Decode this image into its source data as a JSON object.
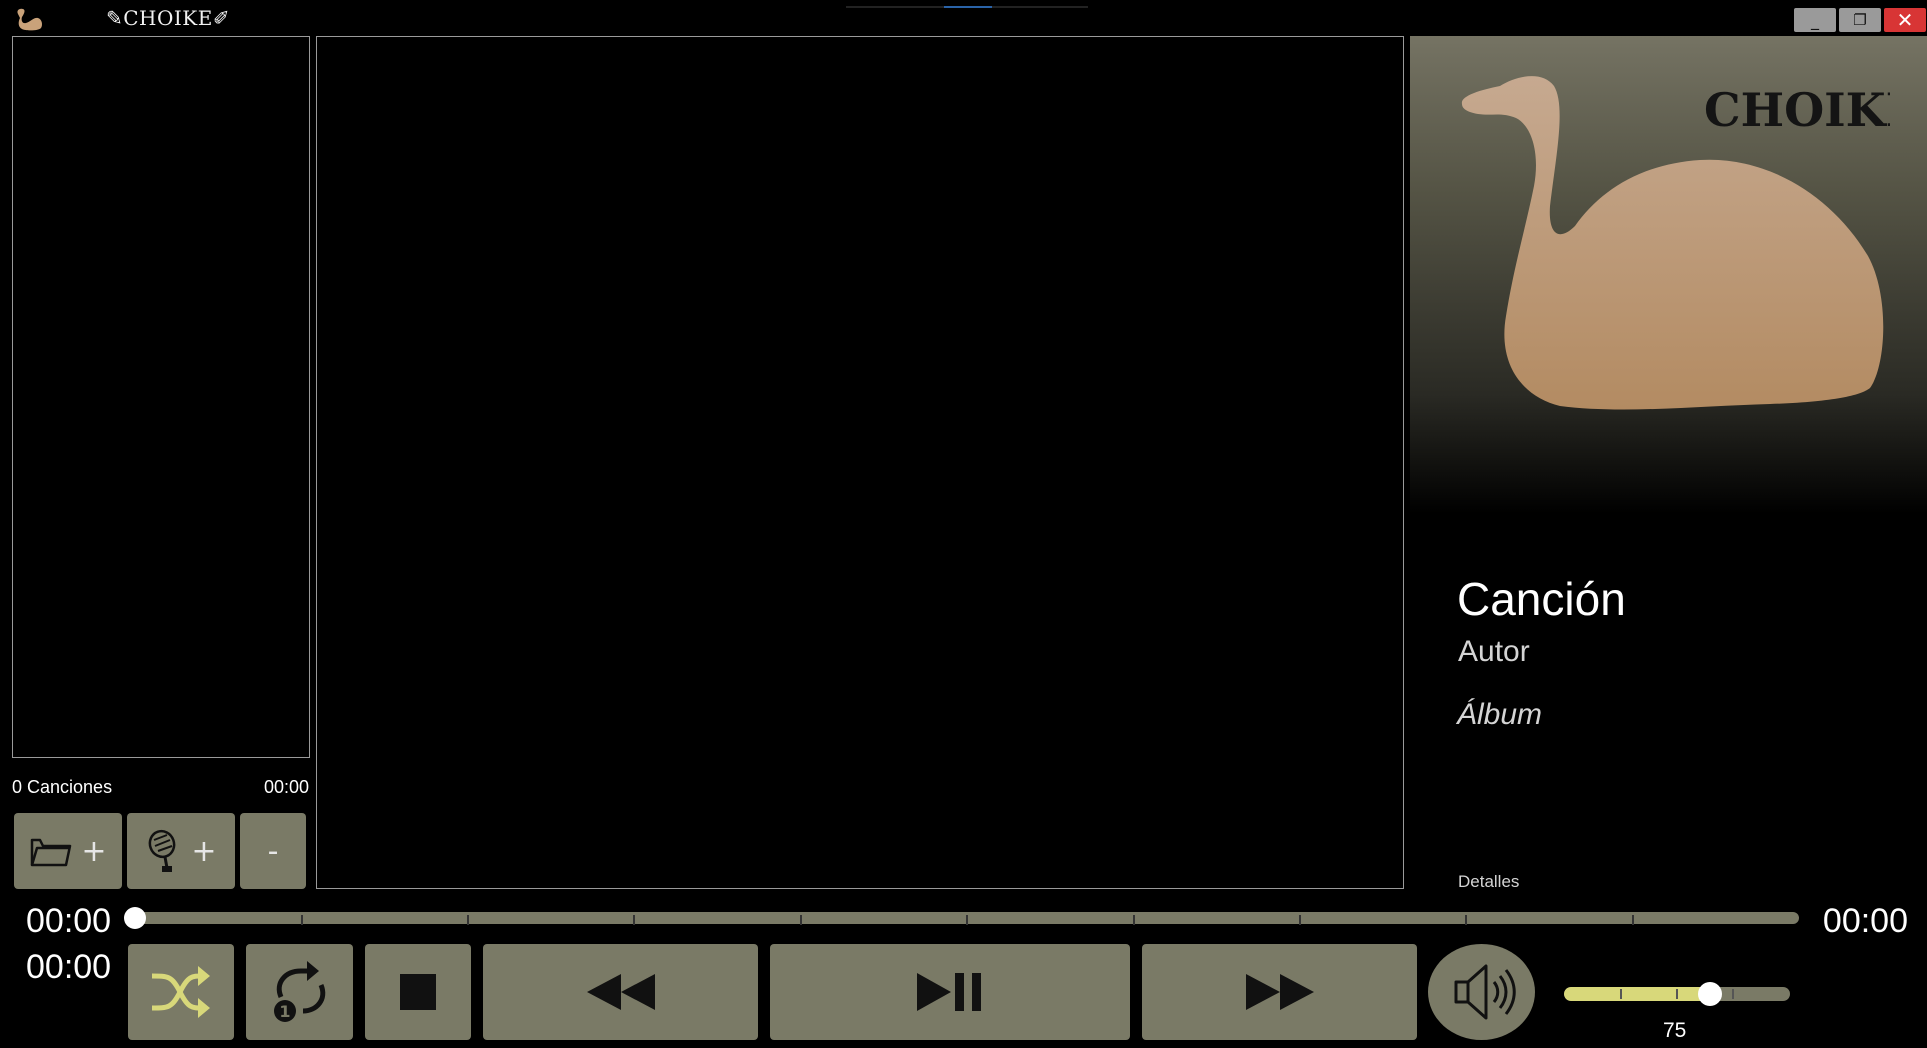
{
  "window": {
    "title": "✎CHOIKE✐",
    "min_label": "_",
    "max_label": "❐",
    "close_label": "✕"
  },
  "playlist": {
    "count_label": "0 Canciones",
    "duration": "00:00",
    "add_folder_plus": "+",
    "add_stream_plus": "+",
    "remove_label": "-"
  },
  "cover": {
    "brand_text": "CHOIKE"
  },
  "now_playing": {
    "title": "Canción",
    "artist": "Autor",
    "album": "Álbum",
    "details_label": "Detalles"
  },
  "seek": {
    "elapsed": "00:00",
    "total": "00:00",
    "current": "00:00",
    "position": 0
  },
  "controls": {
    "shuffle_icon": "shuffle-icon",
    "repeat_icon": "repeat-one-icon",
    "stop_icon": "stop-icon",
    "rewind_icon": "rewind-icon",
    "play_pause_icon": "play-pause-icon",
    "forward_icon": "fast-forward-icon",
    "mute_icon": "speaker-icon"
  },
  "volume": {
    "value": "75",
    "level": 0.75
  },
  "colors": {
    "button_bg": "#7a7a66",
    "accent": "#d8d87a",
    "close": "#d83535"
  }
}
